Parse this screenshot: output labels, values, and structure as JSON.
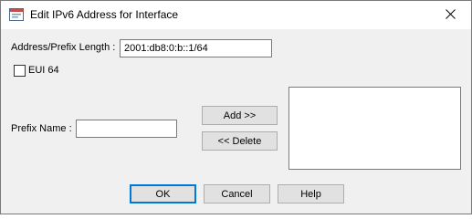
{
  "window": {
    "title": "Edit IPv6 Address for Interface",
    "app_icon": "window-app-icon",
    "close_icon": "close-icon"
  },
  "form": {
    "address_label": "Address/Prefix Length :",
    "address_value": "2001:db8:0:b::1/64",
    "eui64_label": "EUI 64",
    "eui64_checked": false,
    "prefix_name_label": "Prefix Name :",
    "prefix_name_value": ""
  },
  "buttons": {
    "add": "Add >>",
    "delete": "<< Delete",
    "ok": "OK",
    "cancel": "Cancel",
    "help": "Help"
  },
  "prefix_list": {
    "items": []
  },
  "colors": {
    "focus_border": "#0078d7",
    "dialog_bg": "#f0f0f0"
  }
}
